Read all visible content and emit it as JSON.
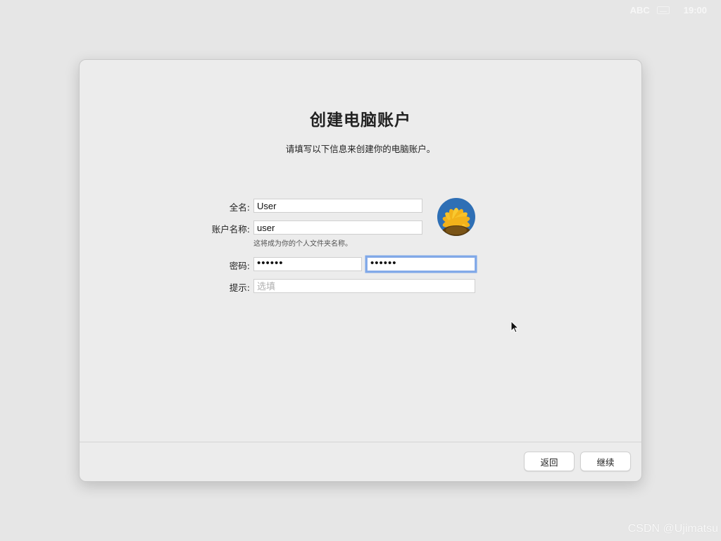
{
  "menubar": {
    "input_source": "ABC",
    "keyboard_icon": "keyboard-icon",
    "clock": "19:00"
  },
  "window": {
    "title": "创建电脑账户",
    "subtitle": "请填写以下信息来创建你的电脑账户。",
    "form": {
      "fullname_label": "全名:",
      "fullname_value": "User",
      "account_label": "账户名称:",
      "account_value": "user",
      "account_help": "这将成为你的个人文件夹名称。",
      "password_label": "密码:",
      "password_value": "••••••",
      "verify_value": "••••••",
      "hint_label": "提示:",
      "hint_placeholder": "选填"
    },
    "avatar": {
      "icon": "sunflower-avatar",
      "colors": {
        "petal": "#f5b81a",
        "sky": "#2e6fb5",
        "center": "#6b4a12"
      }
    },
    "buttons": {
      "back_label": "返回",
      "continue_label": "继续"
    }
  },
  "watermark": "CSDN @Ujimatsu",
  "colors": {
    "background": "#e6e6e6",
    "window": "#ececec",
    "focus_ring": "#7fa8e8"
  }
}
